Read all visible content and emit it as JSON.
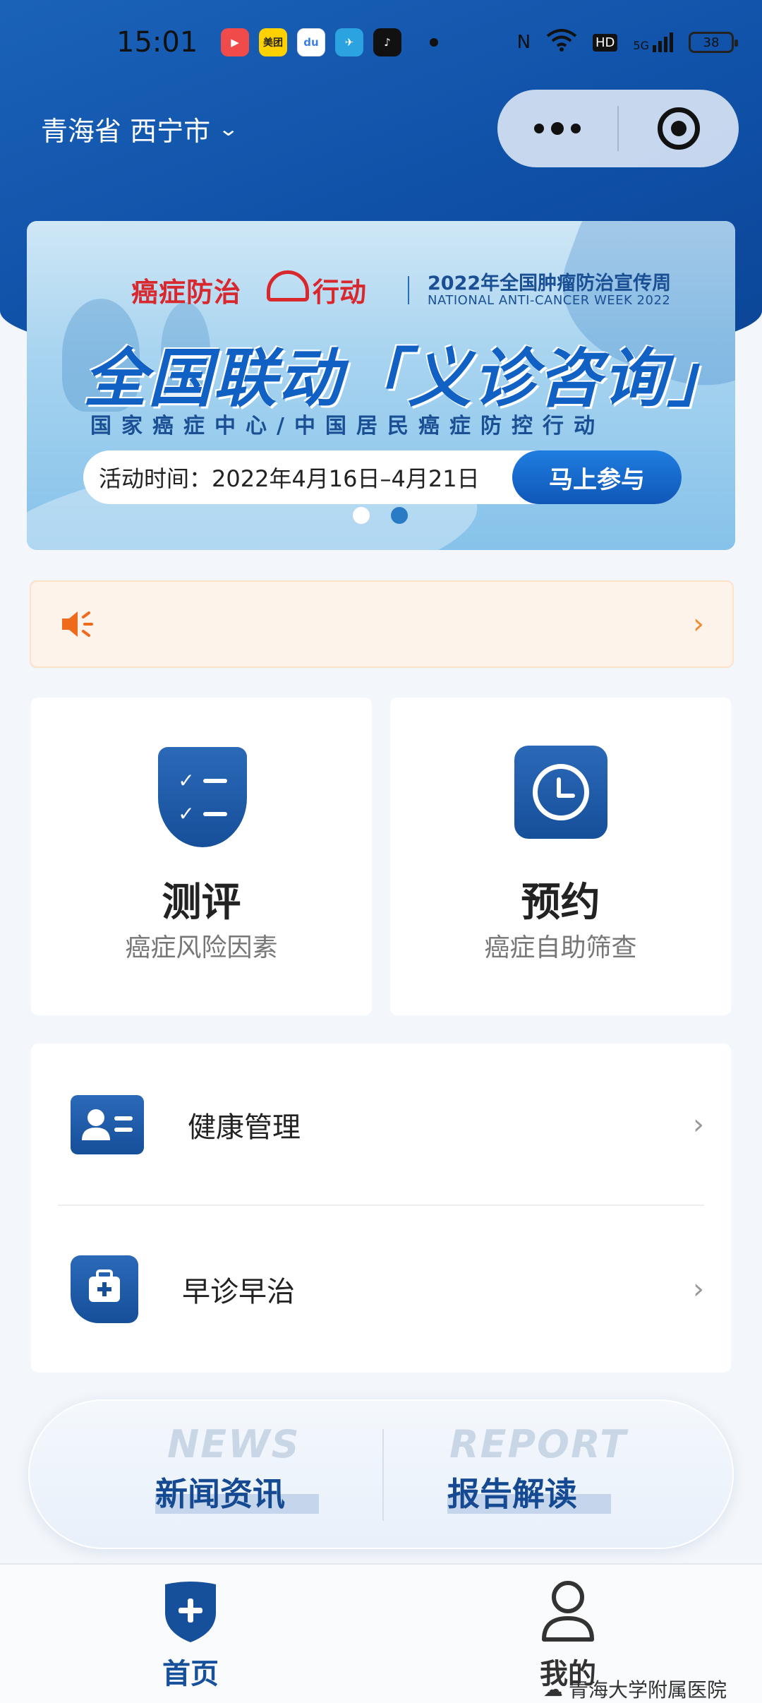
{
  "status_bar": {
    "time": "15:01",
    "apps": [
      {
        "name": "video-app",
        "label": "▶",
        "color": "#f04a4a"
      },
      {
        "name": "meituan-app",
        "label": "美团",
        "color": "#ffd100"
      },
      {
        "name": "baidu-app",
        "label": "du",
        "color": "#3b7ee8"
      },
      {
        "name": "telegram-app",
        "label": "✈",
        "color": "#2aa3e0"
      },
      {
        "name": "tiktok-app",
        "label": "♪",
        "color": "#111111"
      }
    ],
    "network": "5G",
    "hd": "HD",
    "battery": "38"
  },
  "header": {
    "location": "青海省 西宁市"
  },
  "banner": {
    "logo_left": "癌症防治",
    "logo_right": "行动",
    "week_cn": "2022年全国肿瘤防治宣传周",
    "week_en": "NATIONAL ANTI-CANCER WEEK 2022",
    "headline": "全国联动「义诊咨询」",
    "subtitle": "国家癌症中心/中国居民癌症防控行动",
    "date_text": "活动时间：2022年4月16日–4月21日",
    "cta": "马上参与",
    "slide_count": 2,
    "active_slide": 2
  },
  "cards": {
    "eval": {
      "title": "测评",
      "subtitle": "癌症风险因素"
    },
    "book": {
      "title": "预约",
      "subtitle": "癌症自助筛查"
    }
  },
  "list": {
    "health": "健康管理",
    "early": "早诊早治"
  },
  "news_report": {
    "news_en": "NEWS",
    "news_cn": "新闻资讯",
    "report_en": "REPORT",
    "report_cn": "报告解读"
  },
  "tabs": {
    "home": "首页",
    "mine": "我的"
  },
  "watermark": "青海大学附属医院",
  "colors": {
    "primary": "#164f9a",
    "notice_bg": "#fdf3ea",
    "notice_accent": "#f08a2c"
  }
}
